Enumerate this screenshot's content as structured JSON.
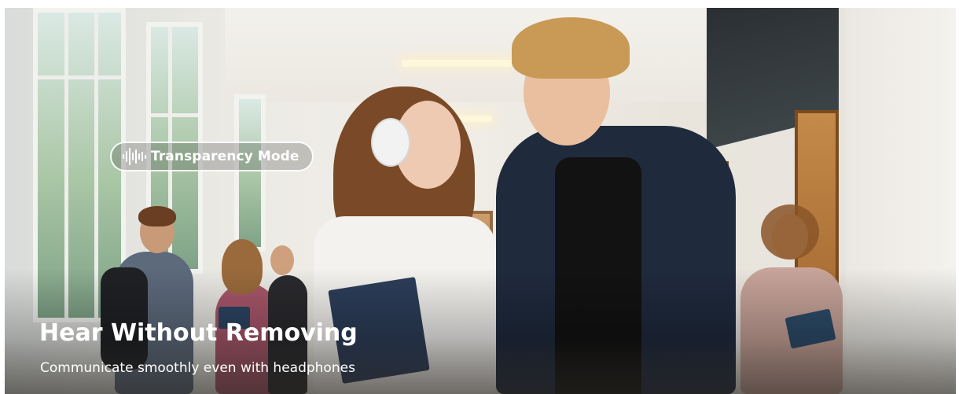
{
  "hero": {
    "pill": {
      "icon": "sound-wave-icon",
      "label": "Transparency Mode"
    },
    "headline": "Hear Without Removing",
    "subheadline": "Communicate smoothly even with headphones",
    "image": {
      "subject": "photo-of-students-in-school-hallway"
    }
  },
  "colors": {
    "text": "#ffffff",
    "pill_border": "#ffffff",
    "headphones": "#f2f2f2",
    "shirt_dark": "#1f2a3d",
    "book": "#2d3e5a"
  }
}
